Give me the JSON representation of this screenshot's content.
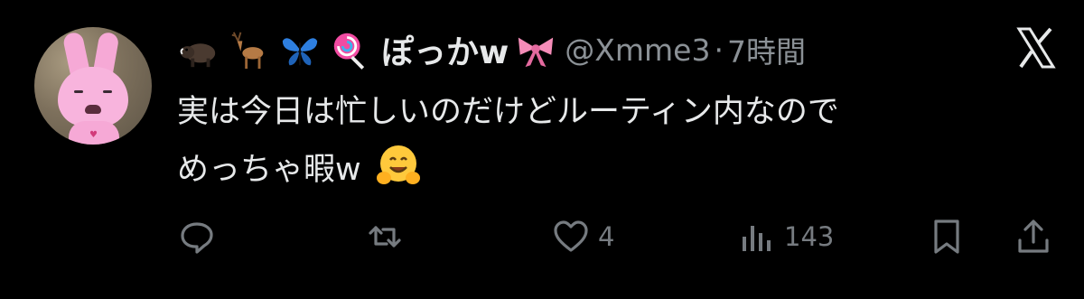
{
  "tweet": {
    "display_name": "ぽっかw",
    "name_emojis_before": [
      "boar-emoji",
      "deer-emoji",
      "butterfly-emoji",
      "lollipop-emoji"
    ],
    "name_emoji_after": "ribbon-emoji",
    "handle": "@Xmme3",
    "separator": "·",
    "time": "7時間",
    "text_line1": "実は今日は忙しいのだけどルーティン内なので",
    "text_line2": "めっちゃ暇w",
    "text_emoji": "hugging-face-emoji"
  },
  "actions": {
    "reply_count": "",
    "retweet_count": "",
    "like_count": "4",
    "view_count": "143"
  },
  "colors": {
    "background": "#000000",
    "text": "#e7e9ea",
    "muted": "#767b80"
  }
}
